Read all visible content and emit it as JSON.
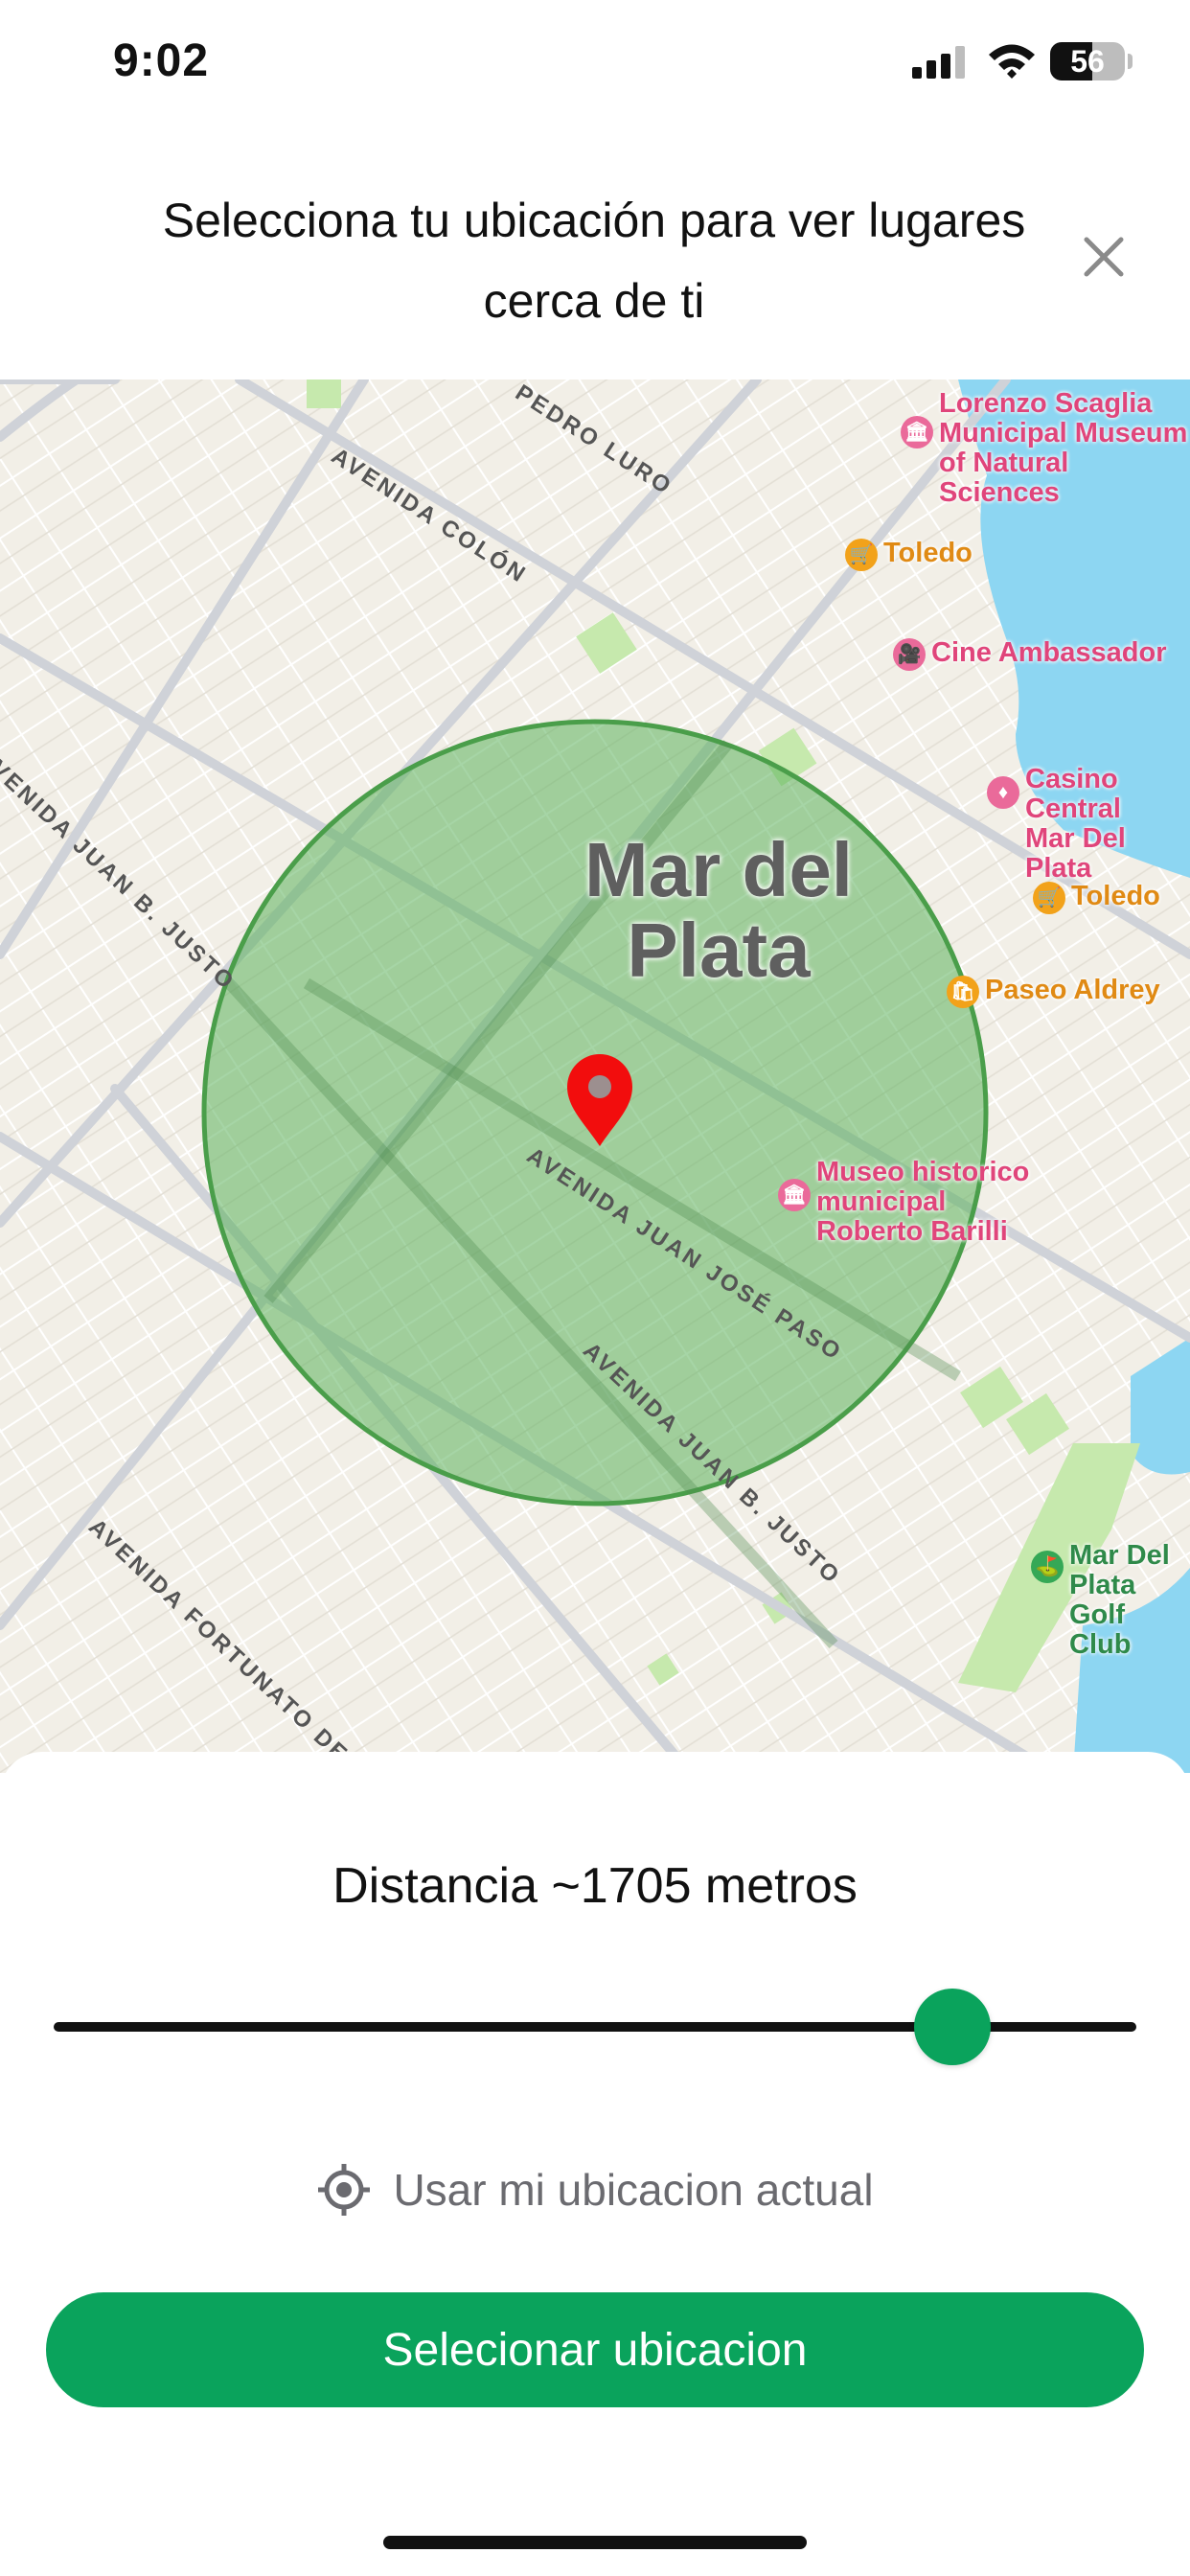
{
  "status_bar": {
    "time": "9:02",
    "battery": "56",
    "battery_level": 0.56
  },
  "header": {
    "title": "Selecciona tu ubicación para ver lugares cerca de ti",
    "close_icon": "close-icon"
  },
  "map": {
    "city_label": "Mar del Plata",
    "streets": [
      "AVENIDA COLÓN",
      "PEDRO LURO",
      "AVENIDA JUAN B. JUSTO",
      "AVENIDA JUAN JOSÉ PASO",
      "AVENIDA JUAN B. JUSTO",
      "AVENIDA FORTUNATO DE LA PLAZA"
    ],
    "pois": [
      {
        "label": "Lorenzo Scaglia\nMunicipal Museum\nof Natural\nSciences",
        "color": "pink",
        "icon": "museum-icon"
      },
      {
        "label": "Toledo",
        "color": "orange",
        "icon": "shopping-cart-icon"
      },
      {
        "label": "Cine Ambassador",
        "color": "pink",
        "icon": "movie-icon"
      },
      {
        "label": "Casino Central\nMar Del Plata",
        "color": "pink",
        "icon": "casino-icon"
      },
      {
        "label": "Toledo",
        "color": "orange",
        "icon": "shopping-cart-icon"
      },
      {
        "label": "Paseo Aldrey",
        "color": "orange",
        "icon": "shopping-bag-icon"
      },
      {
        "label": "Museo historico\nmunicipal\nRoberto Barilli",
        "color": "pink",
        "icon": "museum-icon"
      },
      {
        "label": "Mar Del Plata\nGolf Club",
        "color": "green",
        "icon": "golf-icon"
      }
    ],
    "pin_icon": "location-pin-icon",
    "radius_color": "#5cb35c"
  },
  "sheet": {
    "distance_label": "Distancia ~1705 metros",
    "slider_fraction": 0.83,
    "use_location_label": "Usar mi ubicacion actual",
    "use_location_icon": "crosshair-icon",
    "select_button": "Selecionar ubicacion"
  },
  "colors": {
    "accent": "#0aa35c",
    "water": "#8dd6f2",
    "park": "#c6e9ad"
  }
}
